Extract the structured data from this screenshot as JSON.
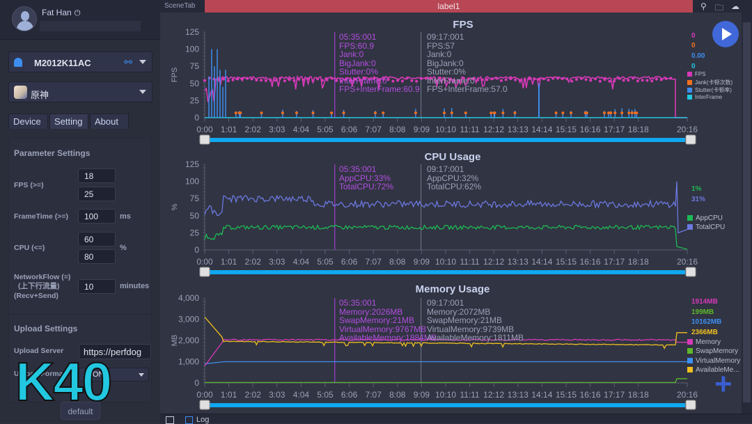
{
  "user": {
    "name": "Fat Han",
    "power_icon": "power-icon"
  },
  "device": {
    "name": "M2012K11AC",
    "icon": "android-icon",
    "connection_icon": "usb-cable-icon"
  },
  "app": {
    "name": "原神"
  },
  "tabs": [
    {
      "label": "Device"
    },
    {
      "label": "Setting"
    },
    {
      "label": "About"
    }
  ],
  "active_tab": "Setting",
  "params": {
    "title": "Parameter Settings",
    "fps_label": "FPS (>=)",
    "fps_values": [
      "18",
      "25"
    ],
    "frametime_label": "FrameTime (>=)",
    "frametime_value": "100",
    "frametime_unit": "ms",
    "cpu_label": "CPU (<=)",
    "cpu_values": [
      "60",
      "80"
    ],
    "cpu_unit": "%",
    "network_label_1": "NetworkFlow (=)",
    "network_label_2": "(上下行流量)",
    "network_label_3": "(Recv+Send)",
    "network_value": "10",
    "network_unit": "minutes"
  },
  "upload": {
    "title": "Upload Settings",
    "server_label": "Upload Server",
    "server_value": "https://perfdog",
    "format_label": "Upload Format",
    "format_value": "JSON"
  },
  "default_button": "default",
  "overlay_text": "K40",
  "topbar": {
    "scene_tab": "SceneTab",
    "label": "label1"
  },
  "bottom": {
    "log_label": "Log"
  },
  "x_ticks": [
    "0:00",
    "1:01",
    "2:02",
    "3:03",
    "4:04",
    "5:05",
    "6:06",
    "7:07",
    "8:08",
    "9:09",
    "10:10",
    "11:11",
    "12:12",
    "13:13",
    "14:14",
    "15:15",
    "16:16",
    "17:17",
    "18:18",
    "20:16"
  ],
  "markers": {
    "a_time": "05:35:001",
    "b_time": "09:17:001"
  },
  "chart_data": [
    {
      "type": "line",
      "title": "FPS",
      "ylabel": "FPS",
      "ylim": [
        0,
        125
      ],
      "yticks": [
        "0",
        "25",
        "50",
        "75",
        "100",
        "125"
      ],
      "xlim_seconds": [
        0,
        1216
      ],
      "series": [
        {
          "name": "FPS",
          "color": "#d63ab8",
          "current": "0",
          "typical": 60
        },
        {
          "name": "Jank(卡顿次数)",
          "color": "#f07020",
          "current": "0"
        },
        {
          "name": "Stutter(卡顿率)",
          "color": "#3d8ef0",
          "current": "0.00"
        },
        {
          "name": "InterFrame",
          "color": "#22c7e0",
          "current": "0"
        }
      ],
      "marker_a": [
        "FPS:60.9",
        "Jank:0",
        "BigJank:0",
        "Stutter:0%",
        "InterFrame:0",
        "FPS+InterFrame:60.9"
      ],
      "marker_b": [
        "FPS:57",
        "Jank:0",
        "BigJank:0",
        "Stutter:0%",
        "InterFrame:0",
        "FPS+InterFrame:57.0"
      ]
    },
    {
      "type": "line",
      "title": "CPU Usage",
      "ylabel": "%",
      "ylim": [
        0,
        125
      ],
      "yticks": [
        "0",
        "25",
        "50",
        "75",
        "100",
        "125"
      ],
      "series": [
        {
          "name": "AppCPU",
          "color": "#1db954",
          "current": "1%",
          "typical": 33
        },
        {
          "name": "TotalCPU",
          "color": "#6b78e0",
          "current": "31%",
          "typical": 70
        }
      ],
      "marker_a": [
        "AppCPU:33%",
        "TotalCPU:72%"
      ],
      "marker_b": [
        "AppCPU:32%",
        "TotalCPU:62%"
      ]
    },
    {
      "type": "line",
      "title": "Memory Usage",
      "ylabel": "MB",
      "ylim": [
        0,
        4000
      ],
      "yticks": [
        "0",
        "1,000",
        "2,000",
        "3,000",
        "4,000"
      ],
      "series": [
        {
          "name": "Memory",
          "color": "#d63ab8",
          "current": "1914MB",
          "typical": 2050
        },
        {
          "name": "SwapMemory",
          "color": "#5cb82a",
          "current": "199MB",
          "typical": 21
        },
        {
          "name": "VirtualMemory",
          "color": "#3d8ef0",
          "current": "10162MB",
          "typical": 1000
        },
        {
          "name": "AvailableMe...",
          "color": "#f0c020",
          "current": "2366MB",
          "typical": 1850
        }
      ],
      "marker_a": [
        "Memory:2026MB",
        "SwapMemory:21MB",
        "VirtualMemory:9767MB",
        "AvailableMemory:1884MB"
      ],
      "marker_b": [
        "Memory:2072MB",
        "SwapMemory:21MB",
        "VirtualMemory:9739MB",
        "AvailableMemory:1811MB"
      ]
    }
  ]
}
